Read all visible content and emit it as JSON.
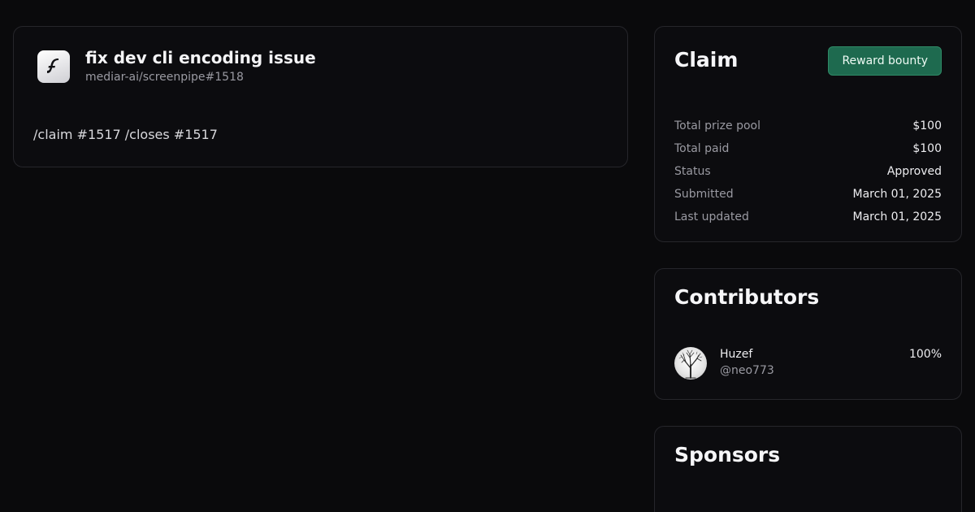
{
  "issue": {
    "title": "fix dev cli encoding issue",
    "reference": "mediar-ai/screenpipe#1518",
    "body": "/claim #1517 /closes #1517",
    "logo_icon": "screenpipe-logo-icon"
  },
  "claim": {
    "heading": "Claim",
    "reward_button_label": "Reward bounty",
    "stats": [
      {
        "label": "Total prize pool",
        "value": "$100"
      },
      {
        "label": "Total paid",
        "value": "$100"
      },
      {
        "label": "Status",
        "value": "Approved"
      },
      {
        "label": "Submitted",
        "value": "March 01, 2025"
      },
      {
        "label": "Last updated",
        "value": "March 01, 2025"
      }
    ]
  },
  "contributors": {
    "heading": "Contributors",
    "items": [
      {
        "name": "Huzef",
        "handle": "@neo773",
        "share": "100%"
      }
    ]
  },
  "sponsors": {
    "heading": "Sponsors"
  },
  "colors": {
    "background": "#0a0a0c",
    "card_border": "#26262b",
    "accent_button": "#1e6a4f"
  }
}
